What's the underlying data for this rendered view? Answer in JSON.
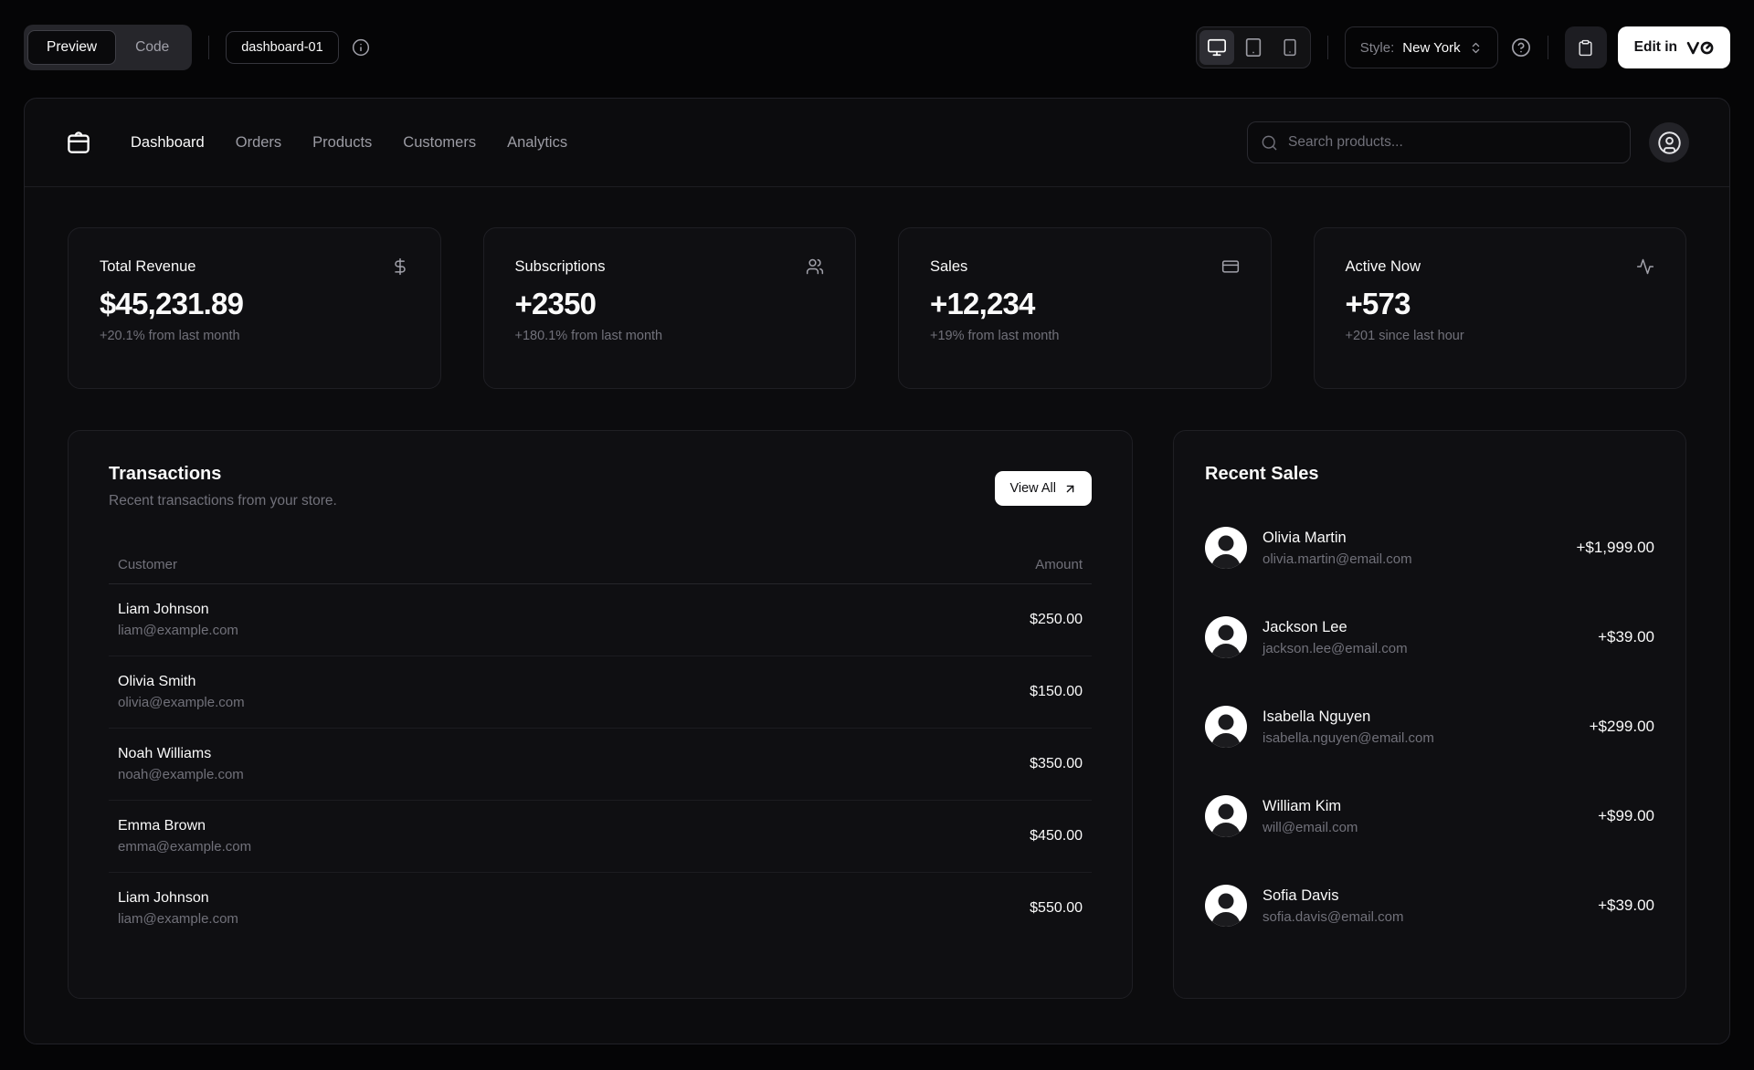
{
  "toolbar": {
    "tabs": [
      {
        "label": "Preview",
        "active": true
      },
      {
        "label": "Code",
        "active": false
      }
    ],
    "block_name": "dashboard-01",
    "style_label": "Style:",
    "style_value": "New York",
    "edit_label": "Edit in"
  },
  "nav": {
    "links": [
      {
        "label": "Dashboard",
        "active": true
      },
      {
        "label": "Orders",
        "active": false
      },
      {
        "label": "Products",
        "active": false
      },
      {
        "label": "Customers",
        "active": false
      },
      {
        "label": "Analytics",
        "active": false
      }
    ],
    "search_placeholder": "Search products..."
  },
  "stats": [
    {
      "title": "Total Revenue",
      "value": "$45,231.89",
      "change": "+20.1% from last month",
      "icon": "dollar-sign-icon"
    },
    {
      "title": "Subscriptions",
      "value": "+2350",
      "change": "+180.1% from last month",
      "icon": "users-icon"
    },
    {
      "title": "Sales",
      "value": "+12,234",
      "change": "+19% from last month",
      "icon": "credit-card-icon"
    },
    {
      "title": "Active Now",
      "value": "+573",
      "change": "+201 since last hour",
      "icon": "activity-icon"
    }
  ],
  "transactions": {
    "title": "Transactions",
    "subtitle": "Recent transactions from your store.",
    "view_all_label": "View All",
    "columns": [
      "Customer",
      "Amount"
    ],
    "rows": [
      {
        "name": "Liam Johnson",
        "email": "liam@example.com",
        "amount": "$250.00"
      },
      {
        "name": "Olivia Smith",
        "email": "olivia@example.com",
        "amount": "$150.00"
      },
      {
        "name": "Noah Williams",
        "email": "noah@example.com",
        "amount": "$350.00"
      },
      {
        "name": "Emma Brown",
        "email": "emma@example.com",
        "amount": "$450.00"
      },
      {
        "name": "Liam Johnson",
        "email": "liam@example.com",
        "amount": "$550.00"
      }
    ]
  },
  "recent_sales": {
    "title": "Recent Sales",
    "items": [
      {
        "name": "Olivia Martin",
        "email": "olivia.martin@email.com",
        "amount": "+$1,999.00"
      },
      {
        "name": "Jackson Lee",
        "email": "jackson.lee@email.com",
        "amount": "+$39.00"
      },
      {
        "name": "Isabella Nguyen",
        "email": "isabella.nguyen@email.com",
        "amount": "+$299.00"
      },
      {
        "name": "William Kim",
        "email": "will@email.com",
        "amount": "+$99.00"
      },
      {
        "name": "Sofia Davis",
        "email": "sofia.davis@email.com",
        "amount": "+$39.00"
      }
    ]
  },
  "icons": {
    "toolbar": [
      "info-icon",
      "monitor-icon",
      "tablet-icon",
      "smartphone-icon",
      "chevrons-up-down-icon",
      "help-circle-icon",
      "clipboard-icon",
      "v0-logo"
    ],
    "nav": [
      "store-icon",
      "search-icon",
      "user-circle-icon"
    ],
    "stats": [
      "dollar-sign-icon",
      "users-icon",
      "credit-card-icon",
      "activity-icon"
    ],
    "transactions": [
      "arrow-up-right-icon"
    ]
  },
  "colors": {
    "page_background": "#050506",
    "panel_background": "#0c0c0e",
    "card_background": "#0f0f12",
    "border": "#1f1f24",
    "foreground": "#fafafa",
    "muted": "#71717a",
    "primary_button": "#ffffff"
  }
}
